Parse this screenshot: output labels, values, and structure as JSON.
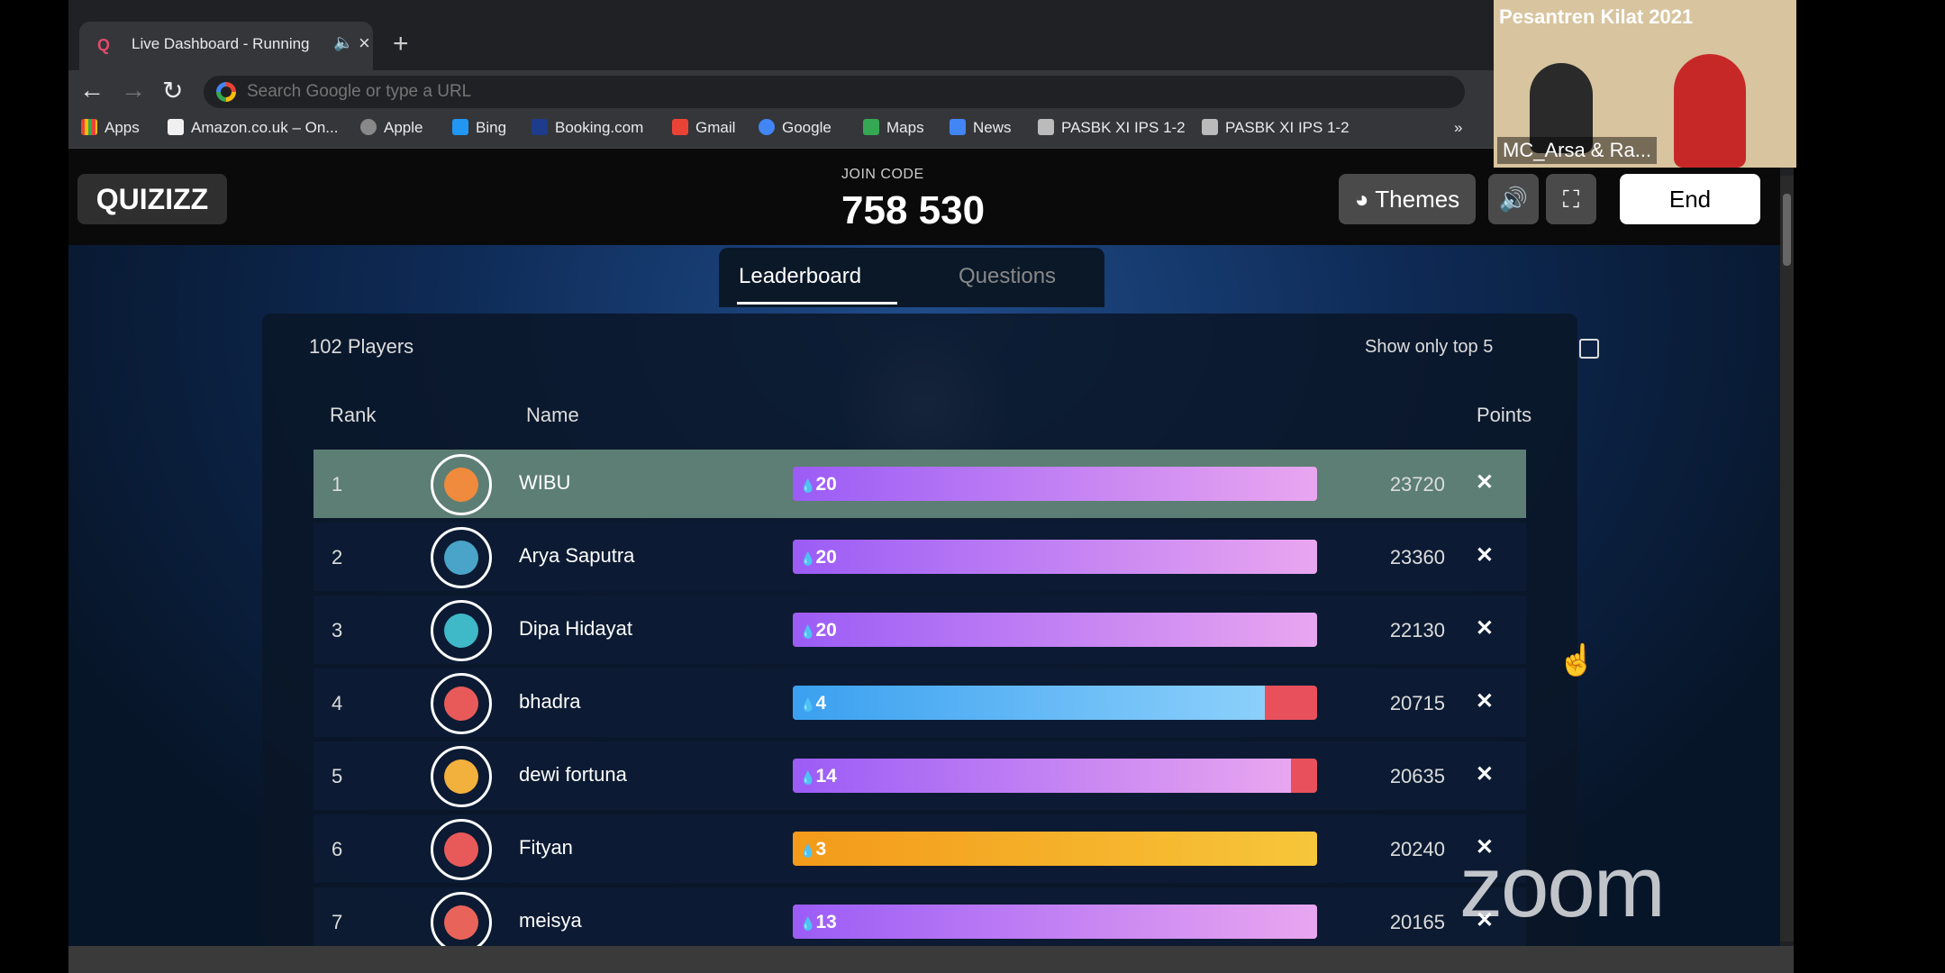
{
  "browser": {
    "tab_title": "Live Dashboard - Running",
    "omnibox_placeholder": "Search Google or type a URL",
    "bookmarks": [
      {
        "label": "Apps",
        "color": "#e8eaed"
      },
      {
        "label": "Amazon.co.uk – On...",
        "color": "#f0f0f0"
      },
      {
        "label": "Apple",
        "color": "#888888"
      },
      {
        "label": "Bing",
        "color": "#2196f3"
      },
      {
        "label": "Booking.com",
        "color": "#1e3c8c"
      },
      {
        "label": "Gmail",
        "color": "#ea4335"
      },
      {
        "label": "Google",
        "color": "#4285f4"
      },
      {
        "label": "Maps",
        "color": "#34a853"
      },
      {
        "label": "News",
        "color": "#4285f4"
      },
      {
        "label": "PASBK XI IPS 1-2",
        "color": "#bbbbbb"
      },
      {
        "label": "PASBK XI IPS 1-2",
        "color": "#bbbbbb"
      }
    ],
    "overflow_icon": "»"
  },
  "header": {
    "logo": "QUIZIZZ",
    "join_label": "JOIN CODE",
    "join_code": "758 530",
    "themes_label": "Themes",
    "end_label": "End"
  },
  "tabs": {
    "leaderboard": "Leaderboard",
    "questions": "Questions"
  },
  "panel": {
    "players_count": "102 Players",
    "top5_label": "Show only top 5",
    "col_rank": "Rank",
    "col_name": "Name",
    "col_points": "Points"
  },
  "players": [
    {
      "rank": "1",
      "name": "WIBU",
      "streak": "20",
      "points": "23720",
      "bar_color": "purple",
      "accuracy": 1.0,
      "avatar_color": "#f08a3c"
    },
    {
      "rank": "2",
      "name": "Arya Saputra",
      "streak": "20",
      "points": "23360",
      "bar_color": "purple",
      "accuracy": 1.0,
      "avatar_color": "#4aa3c8"
    },
    {
      "rank": "3",
      "name": "Dipa Hidayat",
      "streak": "20",
      "points": "22130",
      "bar_color": "purple",
      "accuracy": 1.0,
      "avatar_color": "#3fb8c8"
    },
    {
      "rank": "4",
      "name": "bhadra",
      "streak": "4",
      "points": "20715",
      "bar_color": "blue",
      "accuracy": 0.9,
      "avatar_color": "#e85a5a"
    },
    {
      "rank": "5",
      "name": "dewi fortuna",
      "streak": "14",
      "points": "20635",
      "bar_color": "purple",
      "accuracy": 0.95,
      "avatar_color": "#f2b03c"
    },
    {
      "rank": "6",
      "name": "Fityan",
      "streak": "3",
      "points": "20240",
      "bar_color": "orange",
      "accuracy": 1.0,
      "avatar_color": "#e85a5a"
    },
    {
      "rank": "7",
      "name": "meisya",
      "streak": "13",
      "points": "20165",
      "bar_color": "purple",
      "accuracy": 1.0,
      "avatar_color": "#e8645a"
    }
  ],
  "overlay": {
    "zoom_logo": "zoom",
    "video_banner": "Pesantren Kilat 2021",
    "video_label": "MC_Arsa & Ra..."
  }
}
